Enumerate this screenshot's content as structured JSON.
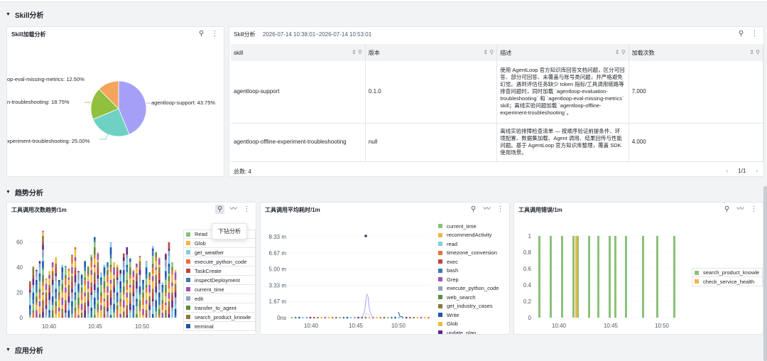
{
  "sections": {
    "skill": "Skill分析",
    "trend": "趋势分析",
    "app": "应用分析"
  },
  "pie_panel": {
    "title": "Skill加载分析",
    "labels": [
      "op-eval-missing-metrics: 12.50%",
      "n-troubleshooting: 18.75%",
      "xperiment-troubleshooting: 25.00%",
      "agentloop-support: 43.75%"
    ]
  },
  "table_panel": {
    "title": "Skill分析",
    "range": "2026-07-14 10:38:01~2026-07-14 10:53:01",
    "columns": [
      "skill",
      "版本",
      "描述",
      "加载次数"
    ],
    "rows": [
      {
        "skill": "agentloop-support",
        "version": "0.1.0",
        "desc": "使用 AgentLoop 官方知识库回答文档问题，区分可回答、部分可回答、未覆盖与账号类问题，并严格避免幻觉。遇到评估任务缺少 token 指标/工具调用链路等排查问题时，同时加载 `agentloop-evaluation-troubleshooting` 和 `agentloop-eval-missing-metrics` skill；离线实验问题加载 `agentloop-offline-experiment-troubleshooting`。",
        "count": "7.000"
      },
      {
        "skill": "agentloop-offline-experiment-troubleshooting",
        "version": "null",
        "desc": "离线实验排障检查清单 — 按顺序验证前提条件、环境配置、数据集加载、Agent 调用、结果回传与性能问题。基于 AgentLoop 官方知识库整理，覆盖 SDK 使用场景。",
        "count": "4.000"
      }
    ],
    "total": "总数: 4",
    "page": "1/1"
  },
  "trend_panels": [
    {
      "title": "工具调用次数趋势/1m",
      "tooltip": "下钻分析",
      "y_ticks": [
        "60",
        "40",
        "20",
        "0"
      ],
      "x_ticks": [
        "10:40",
        "10:45",
        "10:50"
      ],
      "legend": [
        "Read",
        "Glob",
        "get_weather",
        "execute_python_code",
        "TaskCreate",
        "inspectDeployment",
        "current_time",
        "edit",
        "transfer_to_agent",
        "search_product_knowle",
        "terminal"
      ]
    },
    {
      "title": "工具调用平均耗时/1m",
      "y_ticks": [
        "8.33 m",
        "6.67 m",
        "5.00 m",
        "3.33 m",
        "1.67 m",
        "0ns"
      ],
      "x_ticks": [
        "10:40",
        "10:45",
        "10:50"
      ],
      "legend": [
        "current_time",
        "recommendActivity",
        "read",
        "timezone_conversion",
        "exec",
        "bash",
        "Grep",
        "execute_python_code",
        "web_search",
        "get_industry_cases",
        "Write",
        "Glob",
        "update_plan"
      ]
    },
    {
      "title": "工具调用错误/1m",
      "y_ticks": [
        "1",
        "0.8",
        "0.6",
        "0.4",
        "0.2",
        "0"
      ],
      "x_ticks": [
        "10:40",
        "10:45",
        "10:50"
      ],
      "legend": [
        "search_product_knowle",
        "check_service_health"
      ]
    }
  ],
  "colors": {
    "accent": "#1664ff",
    "pie": [
      "#a5a0f7",
      "#6fd1c4",
      "#8fc13e",
      "#f5a55b"
    ],
    "series": [
      "#8bc17a",
      "#f5b544",
      "#7fd0dc",
      "#e4733f",
      "#c4443a",
      "#3c78b4",
      "#a252b4",
      "#92a2c0",
      "#5c8c3c",
      "#8a7840",
      "#1e54b0",
      "#e8c040",
      "#5a2a80"
    ]
  },
  "chart_data": [
    {
      "type": "pie",
      "title": "Skill加载分析",
      "categories": [
        "agentloop-support",
        "xperiment-troubleshooting",
        "n-troubleshooting",
        "op-eval-missing-metrics"
      ],
      "values": [
        43.75,
        25.0,
        18.75,
        12.5
      ]
    },
    {
      "type": "bar",
      "title": "工具调用次数趋势/1m",
      "stacked": true,
      "x": [
        "10:40",
        "10:45",
        "10:50"
      ],
      "ylim": [
        0,
        70
      ],
      "approx_total_per_minute": [
        29,
        41,
        38,
        45,
        69,
        31,
        37,
        44,
        48,
        30,
        42,
        41,
        39,
        50,
        56,
        37,
        35,
        45,
        41,
        50,
        64,
        52,
        36,
        42,
        44,
        60,
        44,
        42,
        38,
        51,
        56,
        47,
        38,
        43,
        49,
        30,
        45,
        36,
        57,
        52,
        48,
        28,
        51,
        60,
        44,
        38
      ]
    },
    {
      "type": "line",
      "title": "工具调用平均耗时/1m",
      "x": [
        "10:40",
        "10:45",
        "10:50"
      ],
      "ylim": [
        0,
        9
      ],
      "y_unit": "m",
      "notable_points": [
        {
          "series": "exec",
          "y": 8.33
        },
        {
          "series": "read",
          "y": 2.9
        }
      ]
    },
    {
      "type": "bar",
      "title": "工具调用错误/1m",
      "x": [
        "10:40",
        "10:45",
        "10:50"
      ],
      "ylim": [
        0,
        1
      ],
      "series": [
        {
          "name": "search_product_knowle",
          "values": [
            1,
            1,
            1,
            1,
            1,
            1,
            1,
            1,
            1,
            1,
            1,
            1,
            1
          ]
        },
        {
          "name": "check_service_health",
          "values": [
            1
          ]
        }
      ]
    }
  ]
}
